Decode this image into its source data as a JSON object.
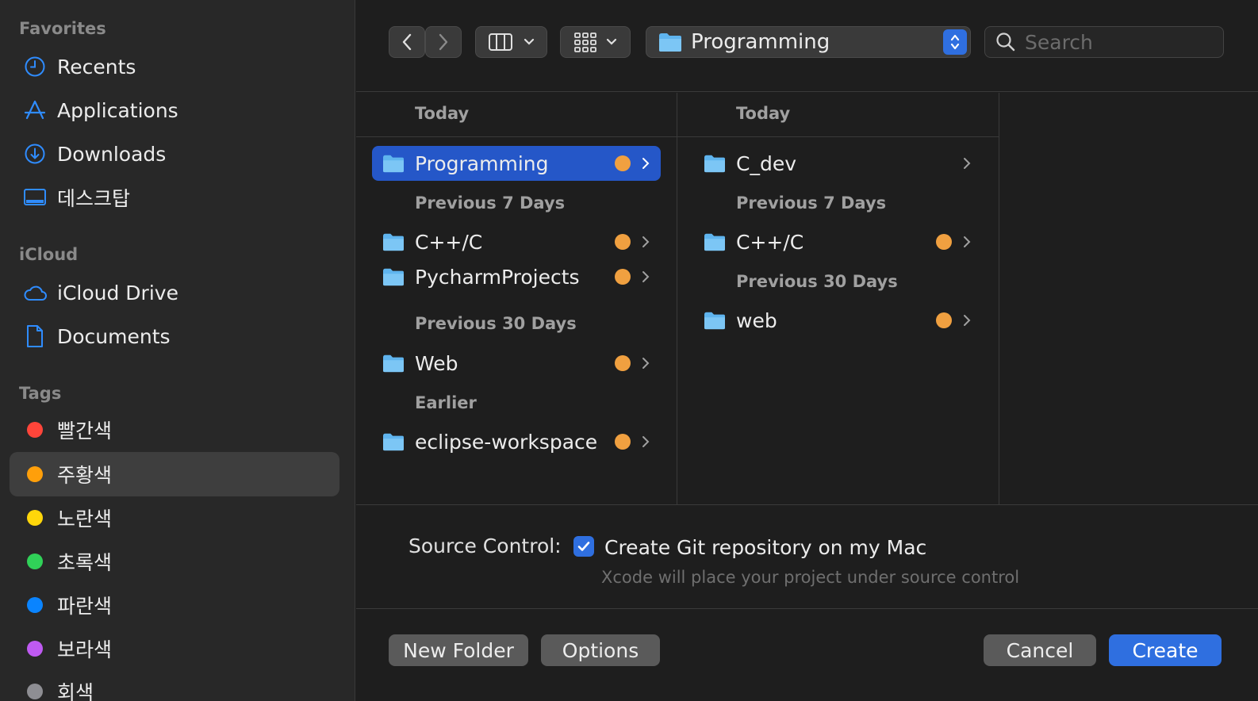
{
  "sidebar": {
    "favorites_title": "Favorites",
    "favorites": [
      {
        "label": "Recents",
        "icon": "clock-icon"
      },
      {
        "label": "Applications",
        "icon": "applications-icon"
      },
      {
        "label": "Downloads",
        "icon": "download-icon"
      },
      {
        "label": "데스크탑",
        "icon": "desktop-icon"
      }
    ],
    "icloud_title": "iCloud",
    "icloud": [
      {
        "label": "iCloud Drive",
        "icon": "cloud-icon"
      },
      {
        "label": "Documents",
        "icon": "document-icon"
      }
    ],
    "tags_title": "Tags",
    "tags": [
      {
        "label": "빨간색",
        "color": "#ff453a"
      },
      {
        "label": "주황색",
        "color": "#ff9f0a"
      },
      {
        "label": "노란색",
        "color": "#ffd60a"
      },
      {
        "label": "초록색",
        "color": "#30d158"
      },
      {
        "label": "파란색",
        "color": "#0a84ff"
      },
      {
        "label": "보라색",
        "color": "#bf5af2"
      },
      {
        "label": "회색",
        "color": "#8e8e93"
      }
    ],
    "selected_tag_index": 1
  },
  "toolbar": {
    "path_label": "Programming",
    "search_placeholder": "Search"
  },
  "columns": [
    {
      "header": "Today",
      "groups": [
        {
          "label": null,
          "items": [
            {
              "name": "Programming",
              "tag": true,
              "selected": true
            }
          ]
        },
        {
          "label": "Previous 7 Days",
          "items": [
            {
              "name": "C++/C",
              "tag": true
            },
            {
              "name": "PycharmProjects",
              "tag": true
            }
          ]
        },
        {
          "label": "Previous 30 Days",
          "items": [
            {
              "name": "Web",
              "tag": true
            }
          ]
        },
        {
          "label": "Earlier",
          "items": [
            {
              "name": "eclipse-workspace",
              "tag": true
            }
          ]
        }
      ]
    },
    {
      "header": "Today",
      "groups": [
        {
          "label": null,
          "items": [
            {
              "name": "C_dev",
              "tag": false
            }
          ]
        },
        {
          "label": "Previous 7 Days",
          "items": [
            {
              "name": "C++/C",
              "tag": true
            }
          ]
        },
        {
          "label": "Previous 30 Days",
          "items": [
            {
              "name": "web",
              "tag": true
            }
          ]
        }
      ]
    }
  ],
  "source_control": {
    "label": "Source Control:",
    "checkbox_label": "Create Git repository on my Mac",
    "checked": true,
    "hint": "Xcode will place your project under source control"
  },
  "buttons": {
    "new_folder": "New Folder",
    "options": "Options",
    "cancel": "Cancel",
    "create": "Create"
  },
  "colors": {
    "accent": "#2f6fe0",
    "selection": "#2557c8",
    "folder": "#5fb4ee",
    "tag_orange": "#f0a040"
  }
}
